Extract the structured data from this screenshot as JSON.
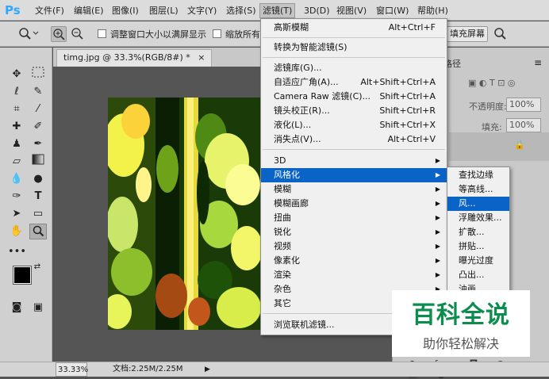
{
  "app": {
    "logo": "Ps"
  },
  "menubar": {
    "items": [
      {
        "label": "文件(F)"
      },
      {
        "label": "编辑(E)"
      },
      {
        "label": "图像(I)"
      },
      {
        "label": "图层(L)"
      },
      {
        "label": "文字(Y)"
      },
      {
        "label": "选择(S)"
      },
      {
        "label": "滤镜(T)"
      },
      {
        "label": "3D(D)"
      },
      {
        "label": "视图(V)"
      },
      {
        "label": "窗口(W)"
      },
      {
        "label": "帮助(H)"
      }
    ]
  },
  "options": {
    "resize_windows": "调整窗口大小以满屏显示",
    "zoom_all": "缩放所有",
    "fill_screen": "填充屏幕"
  },
  "document": {
    "tab_title": "timg.jpg @ 33.3%(RGB/8#) *",
    "close": "×"
  },
  "status": {
    "zoom": "33.33%",
    "doc_info": "文档:2.25M/2.25M"
  },
  "filter_menu": {
    "items": [
      {
        "label": "高斯模糊",
        "shortcut": "Alt+Ctrl+F"
      },
      {
        "label": "转换为智能滤镜(S)",
        "shortcut": ""
      },
      {
        "label": "滤镜库(G)...",
        "shortcut": ""
      },
      {
        "label": "自适应广角(A)...",
        "shortcut": "Alt+Shift+Ctrl+A"
      },
      {
        "label": "Camera Raw 滤镜(C)...",
        "shortcut": "Shift+Ctrl+A"
      },
      {
        "label": "镜头校正(R)...",
        "shortcut": "Shift+Ctrl+R"
      },
      {
        "label": "液化(L)...",
        "shortcut": "Shift+Ctrl+X"
      },
      {
        "label": "消失点(V)...",
        "shortcut": "Alt+Ctrl+V"
      },
      {
        "label": "3D",
        "shortcut": ""
      },
      {
        "label": "风格化",
        "shortcut": ""
      },
      {
        "label": "模糊",
        "shortcut": ""
      },
      {
        "label": "模糊画廊",
        "shortcut": ""
      },
      {
        "label": "扭曲",
        "shortcut": ""
      },
      {
        "label": "锐化",
        "shortcut": ""
      },
      {
        "label": "视频",
        "shortcut": ""
      },
      {
        "label": "像素化",
        "shortcut": ""
      },
      {
        "label": "渲染",
        "shortcut": ""
      },
      {
        "label": "杂色",
        "shortcut": ""
      },
      {
        "label": "其它",
        "shortcut": ""
      },
      {
        "label": "浏览联机滤镜...",
        "shortcut": ""
      }
    ]
  },
  "stylize_submenu": {
    "items": [
      {
        "label": "查找边缘"
      },
      {
        "label": "等高线..."
      },
      {
        "label": "风..."
      },
      {
        "label": "浮雕效果..."
      },
      {
        "label": "扩散..."
      },
      {
        "label": "拼贴..."
      },
      {
        "label": "曝光过度"
      },
      {
        "label": "凸出..."
      },
      {
        "label": "油画..."
      }
    ]
  },
  "right_panel": {
    "tab_label": "路径",
    "opacity_label": "不透明度:",
    "opacity_value": "100%",
    "fill_label": "填充:",
    "fill_value": "100%"
  },
  "watermark": {
    "title": "百科全说",
    "subtitle": "助你轻松解决"
  },
  "colors": {
    "highlight": "#0a64c7",
    "menu_bg": "#f0f0f0",
    "watermark_green": "#0c8d4e"
  }
}
